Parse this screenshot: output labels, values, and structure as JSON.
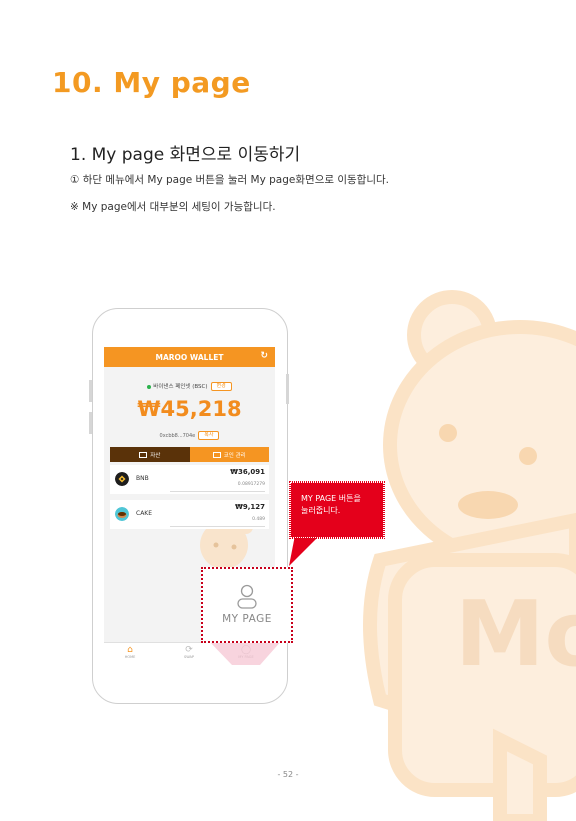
{
  "heading": {
    "title": "10. My page"
  },
  "section": {
    "title": "1. My page 화면으로 이동하기",
    "line1": "① 하단 메뉴에서 My page 버튼을 눌러 My page화면으로 이동합니다.",
    "line2": "※ My page에서 대부분의 세팅이 가능합니다."
  },
  "app": {
    "header_title": "MAROO WALLET",
    "network_label": "바이낸스 페인넷 (BSC)",
    "network_change": "변경",
    "balance": "₩45,218",
    "address": "0xcbb8...704e",
    "copy_label": "복사",
    "tab_assets": "자산",
    "tab_coin_manage": "코인 관리",
    "coins": [
      {
        "name": "BNB",
        "value": "₩36,091",
        "amount": "0.08917279"
      },
      {
        "name": "CAKE",
        "value": "₩9,127",
        "amount": "0.489"
      }
    ],
    "nav": [
      {
        "icon": "home-icon",
        "label": "HOME"
      },
      {
        "icon": "swap-icon",
        "label": "SWAP"
      },
      {
        "icon": "user-icon",
        "label": "MY PAGE"
      }
    ]
  },
  "highlight": {
    "label": "MY PAGE"
  },
  "callout": {
    "line1": "MY PAGE 버튼을",
    "line2": "눌러줍니다."
  },
  "footer": {
    "page_number": "- 52 -"
  },
  "colors": {
    "accent": "#f59522",
    "title": "#f39a22",
    "callout": "#e4001b",
    "asset_tab": "#5a3209"
  }
}
